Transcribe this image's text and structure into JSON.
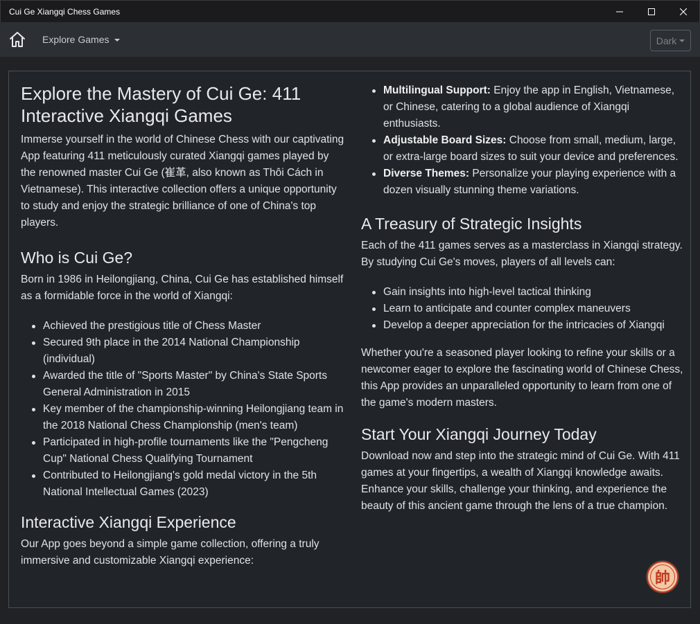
{
  "window": {
    "title": "Cui Ge Xiangqi Chess Games"
  },
  "navbar": {
    "explore_label": "Explore Games",
    "theme_label": "Dark"
  },
  "left": {
    "h1": "Explore the Mastery of Cui Ge: 411 Interactive Xiangqi Games",
    "intro": "Immerse yourself in the world of Chinese Chess with our captivating App featuring 411 meticulously curated Xiangqi games played by the renowned master Cui Ge (崔革, also known as Thôi Cách in Vietnamese). This interactive collection offers a unique opportunity to study and enjoy the strategic brilliance of one of China's top players.",
    "who_h": "Who is Cui Ge?",
    "who_p": "Born in 1986 in Heilongjiang, China, Cui Ge has established himself as a formidable force in the world of Xiangqi:",
    "achievements": [
      "Achieved the prestigious title of Chess Master",
      "Secured 9th place in the 2014 National Championship (individual)",
      "Awarded the title of \"Sports Master\" by China's State Sports General Administration in 2015",
      "Key member of the championship-winning Heilongjiang team in the 2018 National Chess Championship (men's team)",
      "Participated in high-profile tournaments like the \"Pengcheng Cup\" National Chess Qualifying Tournament",
      "Contributed to Heilongjiang's gold medal victory in the 5th National Intellectual Games (2023)"
    ],
    "exp_h": "Interactive Xiangqi Experience",
    "exp_p": "Our App goes beyond a simple game collection, offering a truly immersive and customizable Xiangqi experience:"
  },
  "right": {
    "features": [
      {
        "bold": "Multilingual Support:",
        "text": " Enjoy the app in English, Vietnamese, or Chinese, catering to a global audience of Xiangqi enthusiasts."
      },
      {
        "bold": "Adjustable Board Sizes:",
        "text": " Choose from small, medium, large, or extra-large board sizes to suit your device and preferences."
      },
      {
        "bold": "Diverse Themes:",
        "text": " Personalize your playing experience with a dozen visually stunning theme variations."
      }
    ],
    "treasury_h": "A Treasury of Strategic Insights",
    "treasury_p": "Each of the 411 games serves as a masterclass in Xiangqi strategy. By studying Cui Ge's moves, players of all levels can:",
    "gains": [
      "Gain insights into high-level tactical thinking",
      "Learn to anticipate and counter complex maneuvers",
      "Develop a deeper appreciation for the intricacies of Xiangqi"
    ],
    "whether_p": "Whether you're a seasoned player looking to refine your skills or a newcomer eager to explore the fascinating world of Chinese Chess, this App provides an unparalleled opportunity to learn from one of the game's modern masters.",
    "start_h": "Start Your Xiangqi Journey Today",
    "start_p": "Download now and step into the strategic mind of Cui Ge. With 411 games at your fingertips, a wealth of Xiangqi knowledge awaits. Enhance your skills, challenge your thinking, and experience the beauty of this ancient game through the lens of a true champion."
  },
  "fab": {
    "glyph": "帥",
    "icon": "xiangqi-general-piece-icon"
  }
}
